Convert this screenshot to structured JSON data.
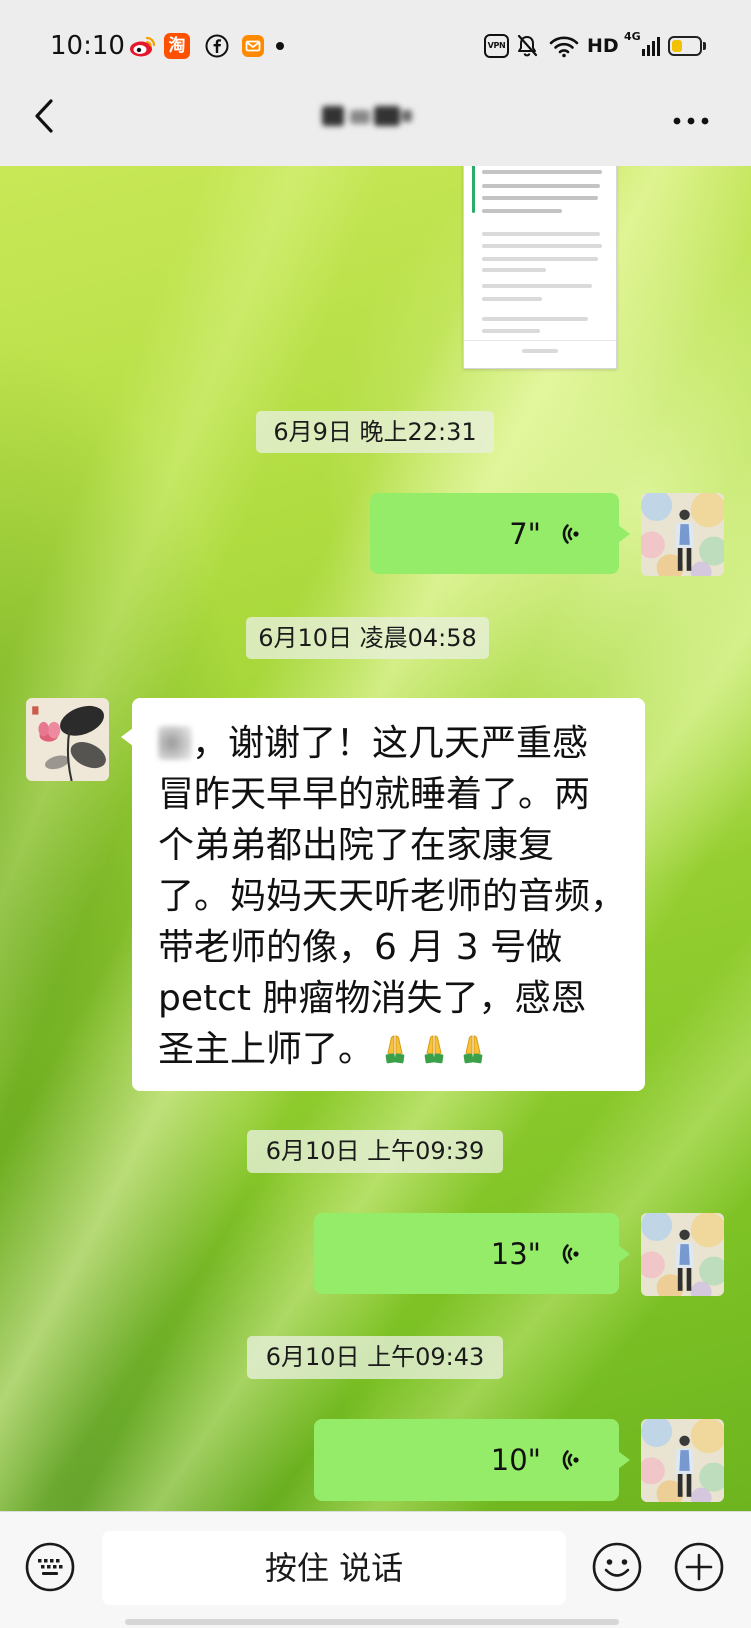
{
  "status_bar": {
    "time": "10:10",
    "taobao_logo_text": "淘",
    "vpn_label": "VPN",
    "hd_label": "HD",
    "network_label": "4G",
    "battery_level": 0.4,
    "icons": [
      "weibo-icon",
      "taobao-icon",
      "facebook-icon",
      "mail-icon",
      "notification-dot",
      "vpn-icon",
      "mute-bell-icon",
      "wifi-icon",
      "signal-icon",
      "battery-icon"
    ]
  },
  "header": {
    "icons": [
      "back-arrow-icon",
      "more-icon"
    ]
  },
  "theme": {
    "top_bar_bg": "#ededed",
    "sent_bubble": "#95ec69",
    "received_bubble": "#ffffff",
    "timestamp_bg": "rgba(232,240,220,0.78)",
    "input_bar_bg": "#f7f7f7",
    "battery_color": "#f2c200"
  },
  "messages": [
    {
      "image_icon": "image-thumbnail"
    },
    {
      "timestamp": "6月9日 晚上22:31"
    },
    {
      "voice_duration": "7\"",
      "voice_icon": "voice-wave-icon"
    },
    {
      "timestamp": "6月10日 凌晨04:58"
    },
    {
      "text_lines": [
        "，谢谢了！这几天严重感",
        "冒昨天早早的就睡着了。两",
        "个弟弟都出院了在家康复",
        "了。妈妈天天听老师的音频，",
        "带老师的像，6 月 3 号做",
        "petct 肿瘤物消失了，感恩",
        "圣主上师了。"
      ],
      "emoji_icons": [
        "folded-hands-icon",
        "folded-hands-icon",
        "folded-hands-icon"
      ]
    },
    {
      "timestamp": "6月10日 上午09:39"
    },
    {
      "voice_duration": "13\"",
      "voice_icon": "voice-wave-icon"
    },
    {
      "timestamp": "6月10日 上午09:43"
    },
    {
      "voice_duration": "10\"",
      "voice_icon": "voice-wave-icon"
    }
  ],
  "input_bar": {
    "hold_to_talk_label": "按住 说话",
    "icons": [
      "keyboard-icon",
      "emoji-icon",
      "plus-icon"
    ]
  }
}
